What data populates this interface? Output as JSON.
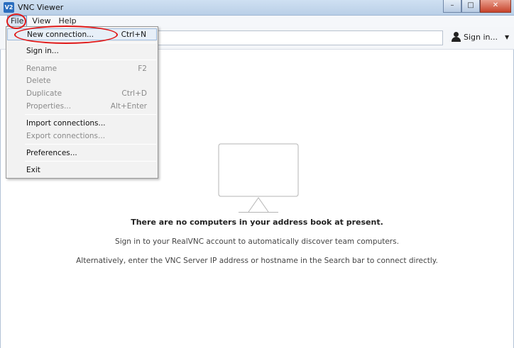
{
  "window": {
    "logo_text": "V2",
    "title": "VNC Viewer",
    "minimize_glyph": "–",
    "maximize_glyph": "□",
    "close_glyph": "✕"
  },
  "menubar": {
    "items": [
      {
        "label": "File"
      },
      {
        "label": "View"
      },
      {
        "label": "Help"
      }
    ]
  },
  "toolbar": {
    "search_value": "",
    "search_placeholder": "",
    "signin_label": "Sign in...",
    "signin_caret": "▼"
  },
  "file_menu": {
    "items": [
      {
        "label": "New connection...",
        "shortcut": "Ctrl+N",
        "enabled": true
      },
      {
        "label": "Sign in...",
        "shortcut": "",
        "enabled": true
      },
      {
        "label": "Rename",
        "shortcut": "F2",
        "enabled": false
      },
      {
        "label": "Delete",
        "shortcut": "",
        "enabled": false
      },
      {
        "label": "Duplicate",
        "shortcut": "Ctrl+D",
        "enabled": false
      },
      {
        "label": "Properties...",
        "shortcut": "Alt+Enter",
        "enabled": false
      },
      {
        "label": "Import connections...",
        "shortcut": "",
        "enabled": true
      },
      {
        "label": "Export connections...",
        "shortcut": "",
        "enabled": false
      },
      {
        "label": "Preferences...",
        "shortcut": "",
        "enabled": true
      },
      {
        "label": "Exit",
        "shortcut": "",
        "enabled": true
      }
    ]
  },
  "empty_state": {
    "heading": "There are no computers in your address book at present.",
    "line1": "Sign in to your RealVNC account to automatically discover team computers.",
    "line2": "Alternatively, enter the VNC Server IP address or hostname in the Search bar to connect directly."
  },
  "colors": {
    "annotation": "#e01818",
    "titlebar": "#c4d7ee",
    "disabled_text": "#8a8a8a"
  }
}
